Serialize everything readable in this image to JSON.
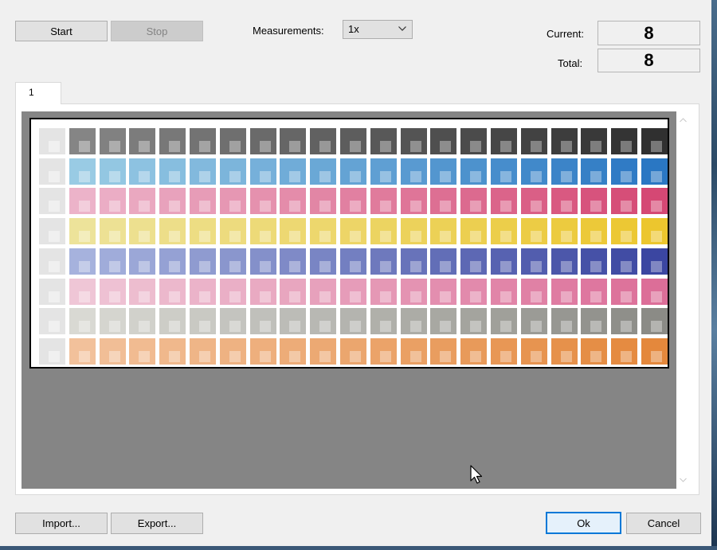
{
  "toolbar": {
    "start_label": "Start",
    "stop_label": "Stop",
    "measurements_label": "Measurements:",
    "measurements_value": "1x"
  },
  "counters": {
    "current_label": "Current:",
    "current_value": "8",
    "total_label": "Total:",
    "total_value": "8"
  },
  "tabs": [
    {
      "label": "1"
    }
  ],
  "chart": {
    "rows": 8,
    "columns": 21,
    "row_colors": [
      {
        "name": "black",
        "light": "#e4e4e4",
        "first": "#858585",
        "last": "#303030"
      },
      {
        "name": "cyan",
        "light": "#e4e4e4",
        "first": "#99cbe4",
        "last": "#2a77c3"
      },
      {
        "name": "magenta",
        "light": "#e4e4e4",
        "first": "#ecb3c9",
        "last": "#d54874"
      },
      {
        "name": "yellow",
        "light": "#e4e4e4",
        "first": "#ede39a",
        "last": "#ecc62e"
      },
      {
        "name": "blue",
        "light": "#e4e4e4",
        "first": "#a6b2dd",
        "last": "#3b46a1"
      },
      {
        "name": "pink",
        "light": "#e4e4e4",
        "first": "#efc6d6",
        "last": "#dc6e98"
      },
      {
        "name": "gray",
        "light": "#e4e4e4",
        "first": "#d9d9d3",
        "last": "#8b8b86"
      },
      {
        "name": "orange",
        "light": "#e4e4e4",
        "first": "#f2c19b",
        "last": "#e4883c"
      }
    ]
  },
  "footer": {
    "import_label": "Import...",
    "export_label": "Export...",
    "ok_label": "Ok",
    "cancel_label": "Cancel"
  },
  "colors": {
    "accent": "#0078d7",
    "canvas_bg": "#858585"
  }
}
